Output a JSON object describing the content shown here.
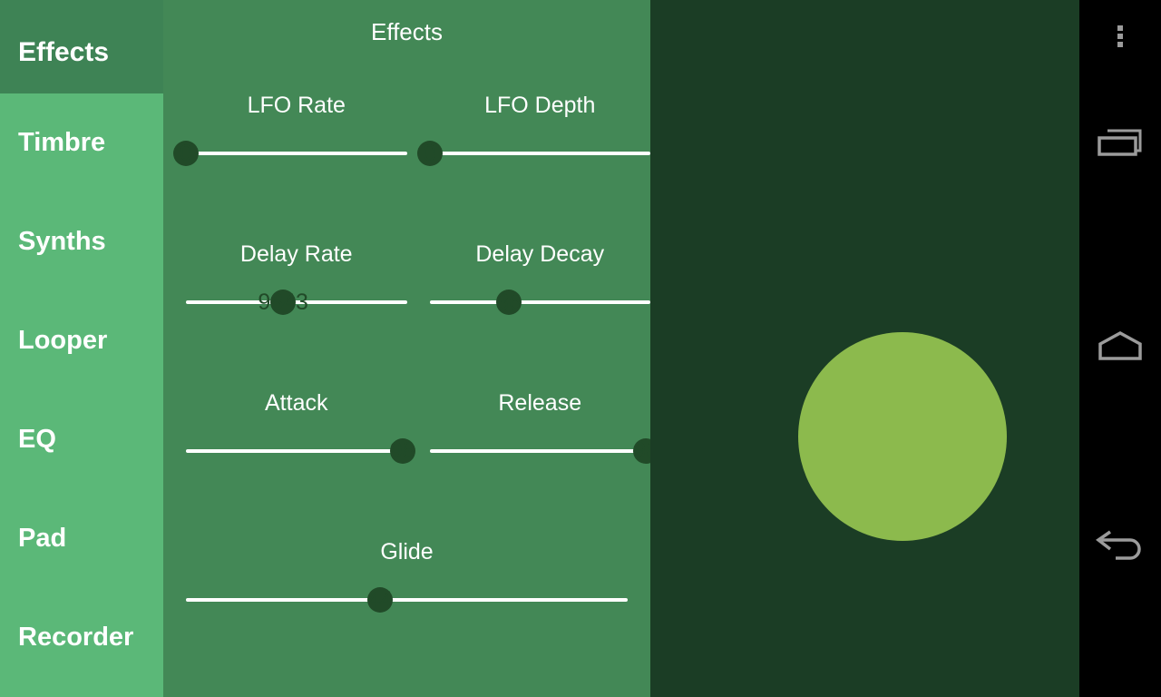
{
  "app": {
    "screen_title": "Effects",
    "colors": {
      "sidebar_header_bg": "#3E8355",
      "sidebar_list_bg": "#5BB878",
      "main_panel_bg": "#438856",
      "visual_panel_bg": "#1B3D25",
      "blob": "#8CBA4D",
      "thumb": "#214A28",
      "track": "#FFFFFF",
      "navbar_bg": "#000000",
      "nav_icon": "#9B9B9B"
    }
  },
  "sidebar": {
    "header_label": "Effects",
    "items": [
      {
        "label": "Timbre",
        "name": "sidebar-item-timbre"
      },
      {
        "label": "Synths",
        "name": "sidebar-item-synths"
      },
      {
        "label": "Looper",
        "name": "sidebar-item-looper"
      },
      {
        "label": "EQ",
        "name": "sidebar-item-eq"
      },
      {
        "label": "Pad",
        "name": "sidebar-item-pad"
      },
      {
        "label": "Recorder",
        "name": "sidebar-item-recorder"
      }
    ]
  },
  "main": {
    "title": "Effects",
    "sliders": [
      {
        "label": "LFO Rate",
        "value": "0",
        "percent": 0
      },
      {
        "label": "LFO Depth",
        "value": "0",
        "percent": 0
      },
      {
        "label": "Delay Rate",
        "value": "9843",
        "percent": 44
      },
      {
        "label": "Delay Decay",
        "value": "36",
        "percent": 36
      },
      {
        "label": "Attack",
        "value": "98",
        "percent": 98
      },
      {
        "label": "Release",
        "value": "98",
        "percent": 98
      },
      {
        "label": "Glide",
        "value": "44",
        "percent": 44
      }
    ]
  },
  "visualizer": {
    "blob_label": "amplitude-blob"
  },
  "navbar": {
    "buttons": [
      {
        "icon": "overflow-menu-icon",
        "label": "More options"
      },
      {
        "icon": "recents-icon",
        "label": "Recent apps"
      },
      {
        "icon": "home-icon",
        "label": "Home"
      },
      {
        "icon": "back-icon",
        "label": "Back"
      }
    ]
  }
}
